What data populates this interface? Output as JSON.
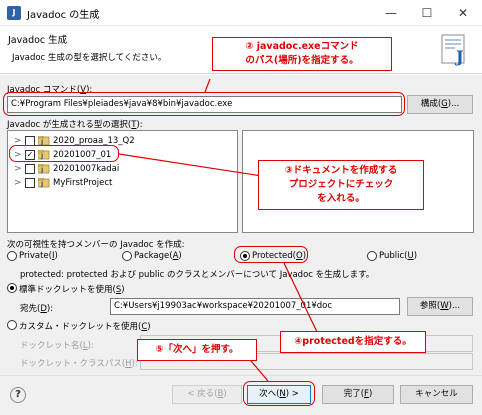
{
  "window": {
    "title": "Javadoc の生成",
    "minimize_glyph": "—",
    "maximize_glyph": "☐",
    "close_glyph": "✕"
  },
  "header": {
    "title": "Javadoc 生成",
    "description": "Javadoc 生成の型を選択してください。"
  },
  "command": {
    "label": "Javadoc コマンド(",
    "mnemonic": "V",
    "label_end": "):",
    "value": "C:¥Program Files¥pleiades¥java¥8¥bin¥javadoc.exe",
    "configure_label": "構成(",
    "configure_mnemonic": "G",
    "configure_end": ")..."
  },
  "types": {
    "label": "Javadoc が生成される型の選択(",
    "mnemonic": "T",
    "label_end": "):",
    "projects": [
      {
        "name": "2020_proaa_13_Q2",
        "checked": false,
        "expandable": true
      },
      {
        "name": "20201007_01",
        "checked": true,
        "expandable": true
      },
      {
        "name": "20201007kadai",
        "checked": false,
        "expandable": true
      },
      {
        "name": "MyFirstProject",
        "checked": false,
        "expandable": true
      }
    ]
  },
  "visibility": {
    "label": "次の可視性を持つメンバーの Javadoc を作成:",
    "options": [
      {
        "label": "Private(",
        "mnemonic": "I",
        "end": ")",
        "selected": false
      },
      {
        "label": "Package(",
        "mnemonic": "A",
        "end": ")",
        "selected": false
      },
      {
        "label": "Protected(",
        "mnemonic": "O",
        "end": ")",
        "selected": true
      },
      {
        "label": "Public(",
        "mnemonic": "U",
        "end": ")",
        "selected": false
      }
    ],
    "description": "protected: protected および public のクラスとメンバーについて Javadoc を生成します。"
  },
  "doclet": {
    "standard_label": "標準ドックレットを使用(",
    "standard_mnemonic": "S",
    "standard_end": ")",
    "standard_selected": true,
    "dest_label": "宛先(",
    "dest_mnemonic": "D",
    "dest_end": "):",
    "dest_value": "C:¥Users¥j19903ac¥workspace¥20201007_01¥doc",
    "browse_label": "参照(",
    "browse_mnemonic": "W",
    "browse_end": ")...",
    "custom_label": "カスタム・ドックレットを使用(",
    "custom_mnemonic": "C",
    "custom_end": ")",
    "custom_selected": false,
    "doclet_name_label": "ドックレット名(",
    "doclet_name_mnemonic": "L",
    "doclet_name_end": "):",
    "classpath_label": "ドックレット・クラスパス(",
    "classpath_mnemonic": "H",
    "classpath_end": "):"
  },
  "footer": {
    "help_glyph": "?",
    "back_label": "< 戻る(",
    "back_mnemonic": "B",
    "back_end": ")",
    "next_label": "次へ(",
    "next_mnemonic": "N",
    "next_end": ") >",
    "finish_label": "完了(",
    "finish_mnemonic": "F",
    "finish_end": ")",
    "cancel_label": "キャンセル"
  },
  "annotations": {
    "step2_line1": "② javadoc.exeコマンド",
    "step2_line2": "のパス(場所)を指定する。",
    "step3_line1": "③ドキュメントを作成する",
    "step3_line2": "プロジェクトにチェック",
    "step3_line3": "を入れる。",
    "step4": "④protectedを指定する。",
    "step5": "⑤「次へ」を押す。",
    "color": "#e00000"
  }
}
